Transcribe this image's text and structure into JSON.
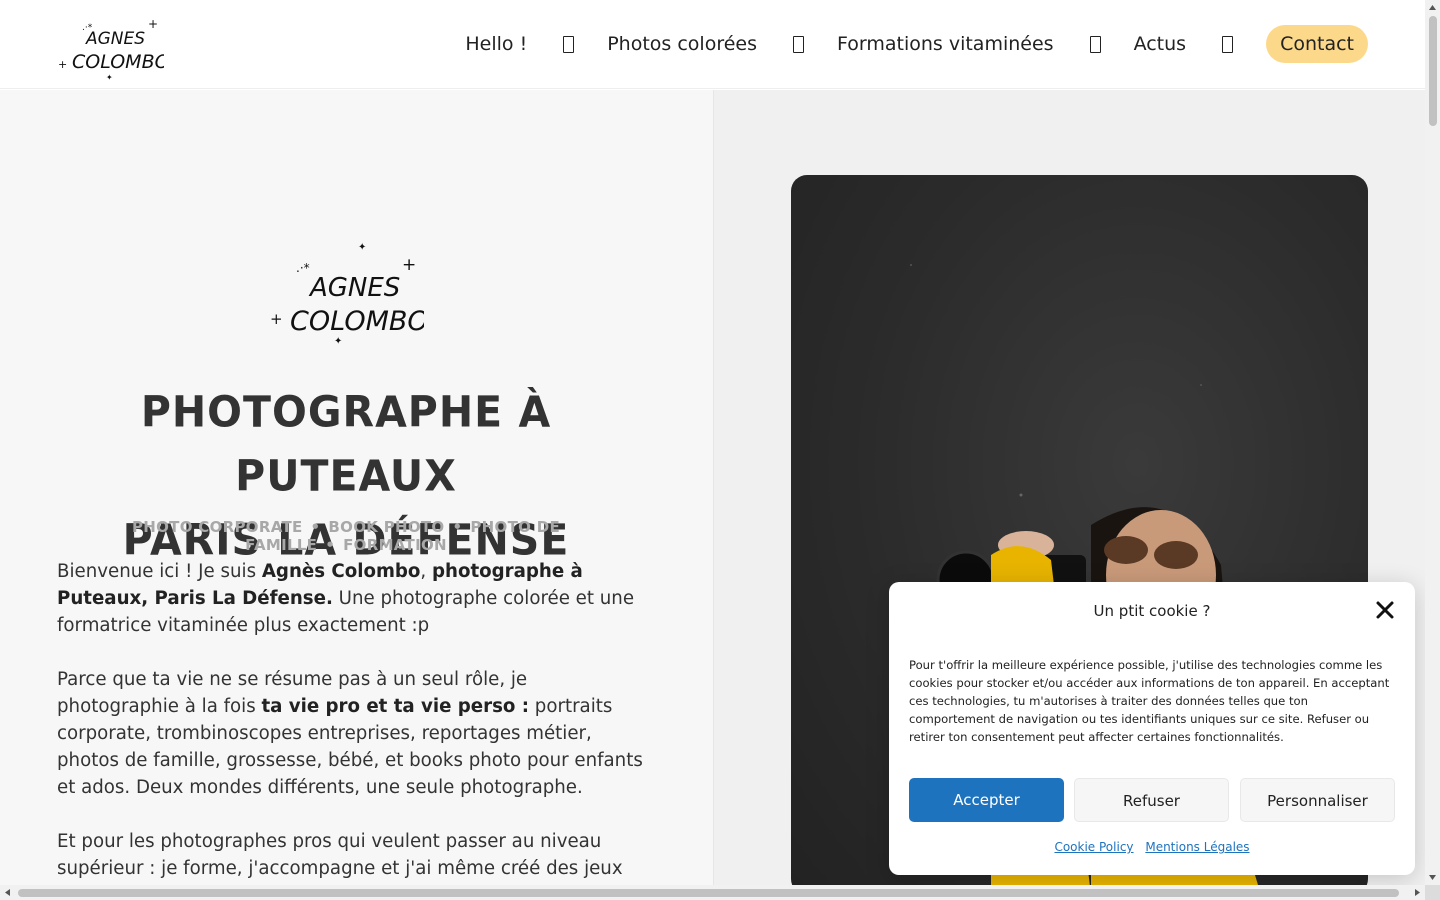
{
  "header": {
    "nav": [
      {
        "label": "Hello !"
      },
      {
        "label": "Photos colorées"
      },
      {
        "label": "Formations vitaminées"
      },
      {
        "label": "Actus"
      }
    ],
    "contact_label": "Contact"
  },
  "logo": {
    "text_line1": "AGNES",
    "text_line2": "COLOMBO"
  },
  "hero": {
    "title_line1": "PHOTOGRAPHE À PUTEAUX",
    "title_line2": "PARIS LA DÉFENSE",
    "subtitle": [
      "PHOTO CORPORATE",
      "BOOK PHOTO",
      "PHOTO DE FAMILLE",
      "FORMATION"
    ]
  },
  "intro": {
    "p1_a": "Bienvenue ici ! Je suis ",
    "p1_b": "Agnès Colombo",
    "p1_c": ", ",
    "p1_d": "photographe à Puteaux, Paris La Défense.",
    "p1_e": " Une photographe colorée et une formatrice vitaminée plus exactement :p",
    "p2_a": "Parce que ta vie ne se résume pas à un seul rôle, je photographie à la fois ",
    "p2_b": "ta vie pro et ta vie perso :",
    "p2_c": " portraits corporate, trombinoscopes entreprises, reportages métier, photos de famille, grossesse, bébé, et books photo pour enfants et ados. Deux mondes différents, une seule photographe.",
    "p3": "Et pour les photographes pros qui veulent passer au niveau supérieur : je forme, j'accompagne et j'ai même créé des jeux"
  },
  "cookie": {
    "title": "Un ptit cookie ?",
    "text": "Pour t'offrir la meilleure expérience possible, j'utilise des technologies comme les cookies pour stocker et/ou accéder aux informations de ton appareil. En acceptant ces technologies, tu m'autorises à traiter des données telles que ton comportement de navigation ou tes identifiants uniques sur ce site. Refuser ou retirer ton consentement peut affecter certaines fonctionnalités.",
    "accept": "Accepter",
    "refuse": "Refuser",
    "customize": "Personnaliser",
    "link_policy": "Cookie Policy",
    "link_legal": "Mentions Légales"
  },
  "colors": {
    "accent": "#1e73be",
    "contact_bg": "#fcd98a"
  }
}
